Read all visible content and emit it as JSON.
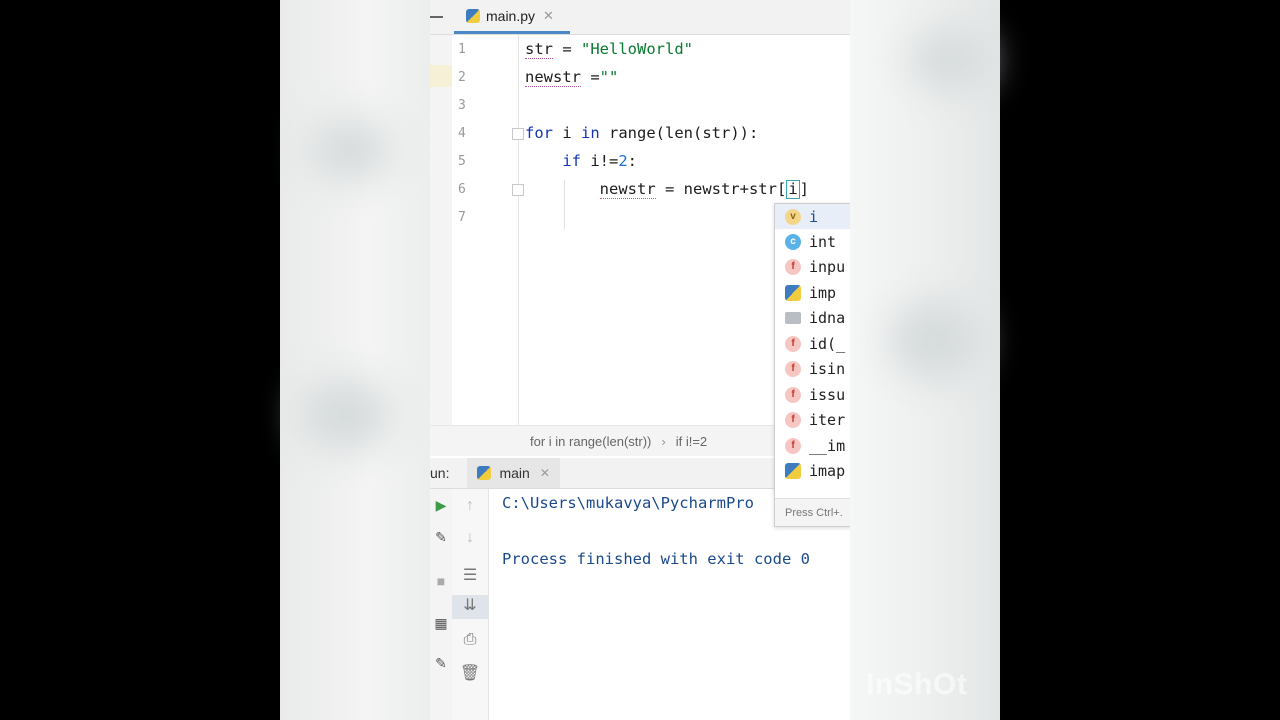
{
  "editor_tab": {
    "filename": "main.py",
    "close": "✕"
  },
  "code_lines": [
    {
      "no": "1"
    },
    {
      "no": "2"
    },
    {
      "no": "3"
    },
    {
      "no": "4"
    },
    {
      "no": "5"
    },
    {
      "no": "6"
    },
    {
      "no": "7"
    }
  ],
  "breadcrumb": {
    "item1": "for i in range(len(str))",
    "separator": "›",
    "item2": "if i!=2"
  },
  "run_panel": {
    "prefix": "un:",
    "tab_label": "main",
    "close": "✕"
  },
  "console": {
    "line1": "C:\\Users\\mukavya\\PycharmPro",
    "line2": "Process finished with exit code 0"
  },
  "autocomplete": {
    "items": [
      {
        "badge": "v",
        "text": "i"
      },
      {
        "badge": "c",
        "text": "int"
      },
      {
        "badge": "f",
        "text": "inpu"
      },
      {
        "badge": "",
        "text": "imp"
      },
      {
        "badge": "",
        "text": "idna"
      },
      {
        "badge": "f",
        "text": "id(_"
      },
      {
        "badge": "f",
        "text": "isin"
      },
      {
        "badge": "f",
        "text": "issu"
      },
      {
        "badge": "f",
        "text": "iter"
      },
      {
        "badge": "f",
        "text": "__im"
      },
      {
        "badge": "",
        "text": "imap"
      }
    ],
    "footer": "Press Ctrl+."
  },
  "watermark": "InShOt",
  "colors": {
    "keyword": "#1535b5",
    "string": "#0a7a30",
    "number": "#1d6fd4",
    "console_text": "#1b4a8c",
    "tab_accent": "#4a88c7"
  }
}
